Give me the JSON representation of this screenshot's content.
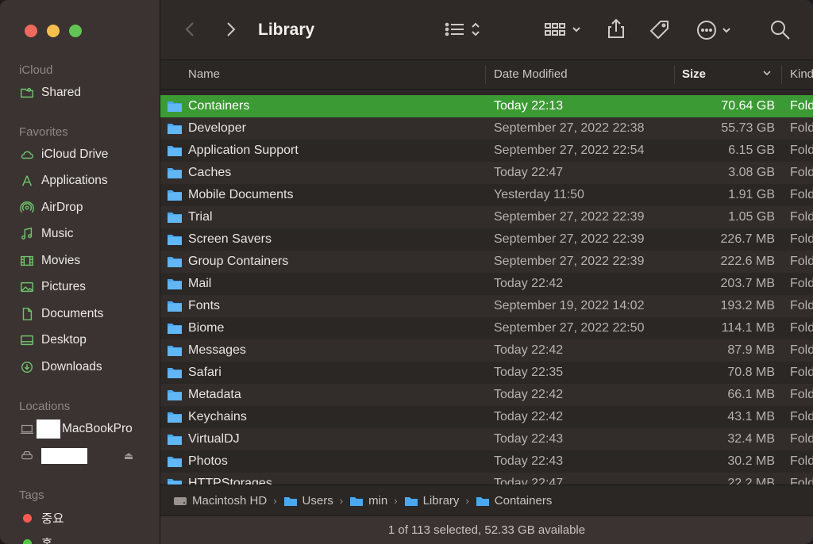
{
  "toolbar": {
    "title": "Library"
  },
  "sidebar": {
    "icloud_header": "iCloud",
    "icloud_items": [
      {
        "label": "Shared",
        "icon": "shared-folder-icon"
      }
    ],
    "favorites_header": "Favorites",
    "favorites": [
      {
        "label": "iCloud Drive",
        "icon": "cloud-icon"
      },
      {
        "label": "Applications",
        "icon": "applications-icon"
      },
      {
        "label": "AirDrop",
        "icon": "airdrop-icon"
      },
      {
        "label": "Music",
        "icon": "music-icon"
      },
      {
        "label": "Movies",
        "icon": "movies-icon"
      },
      {
        "label": "Pictures",
        "icon": "pictures-icon"
      },
      {
        "label": "Documents",
        "icon": "document-icon"
      },
      {
        "label": "Desktop",
        "icon": "desktop-icon"
      },
      {
        "label": "Downloads",
        "icon": "downloads-icon"
      }
    ],
    "locations_header": "Locations",
    "locations": [
      {
        "label": "MacBookPro",
        "icon": "laptop-icon"
      }
    ],
    "tags_header": "Tags",
    "tags": [
      {
        "label": "중요",
        "color": "#ff5a52"
      },
      {
        "label": "홈",
        "color": "#55c747"
      }
    ]
  },
  "columns": {
    "name": "Name",
    "date": "Date Modified",
    "size": "Size",
    "kind": "Kind"
  },
  "rows": [
    {
      "name": "Containers",
      "date": "Today 22:13",
      "size": "70.64 GB",
      "kind": "Folder",
      "selected": true
    },
    {
      "name": "Developer",
      "date": "September 27, 2022 22:38",
      "size": "55.73 GB",
      "kind": "Folder"
    },
    {
      "name": "Application Support",
      "date": "September 27, 2022 22:54",
      "size": "6.15 GB",
      "kind": "Folder"
    },
    {
      "name": "Caches",
      "date": "Today 22:47",
      "size": "3.08 GB",
      "kind": "Folder"
    },
    {
      "name": "Mobile Documents",
      "date": "Yesterday 11:50",
      "size": "1.91 GB",
      "kind": "Folder"
    },
    {
      "name": "Trial",
      "date": "September 27, 2022 22:39",
      "size": "1.05 GB",
      "kind": "Folder"
    },
    {
      "name": "Screen Savers",
      "date": "September 27, 2022 22:39",
      "size": "226.7 MB",
      "kind": "Folder"
    },
    {
      "name": "Group Containers",
      "date": "September 27, 2022 22:39",
      "size": "222.6 MB",
      "kind": "Folder"
    },
    {
      "name": "Mail",
      "date": "Today 22:42",
      "size": "203.7 MB",
      "kind": "Folder"
    },
    {
      "name": "Fonts",
      "date": "September 19, 2022 14:02",
      "size": "193.2 MB",
      "kind": "Folder"
    },
    {
      "name": "Biome",
      "date": "September 27, 2022 22:50",
      "size": "114.1 MB",
      "kind": "Folder"
    },
    {
      "name": "Messages",
      "date": "Today 22:42",
      "size": "87.9 MB",
      "kind": "Folder"
    },
    {
      "name": "Safari",
      "date": "Today 22:35",
      "size": "70.8 MB",
      "kind": "Folder"
    },
    {
      "name": "Metadata",
      "date": "Today 22:42",
      "size": "66.1 MB",
      "kind": "Folder"
    },
    {
      "name": "Keychains",
      "date": "Today 22:42",
      "size": "43.1 MB",
      "kind": "Folder"
    },
    {
      "name": "VirtualDJ",
      "date": "Today 22:43",
      "size": "32.4 MB",
      "kind": "Folder"
    },
    {
      "name": "Photos",
      "date": "Today 22:43",
      "size": "30.2 MB",
      "kind": "Folder"
    },
    {
      "name": "HTTPStorages",
      "date": "Today 22:47",
      "size": "22.2 MB",
      "kind": "Folder"
    }
  ],
  "pathbar": [
    "Macintosh HD",
    "Users",
    "min",
    "Library",
    "Containers"
  ],
  "status": "1 of 113 selected, 52.33 GB available",
  "colors": {
    "accent": "#61c554",
    "selection": "#3b9a33",
    "folder": "#4aa8f0"
  }
}
